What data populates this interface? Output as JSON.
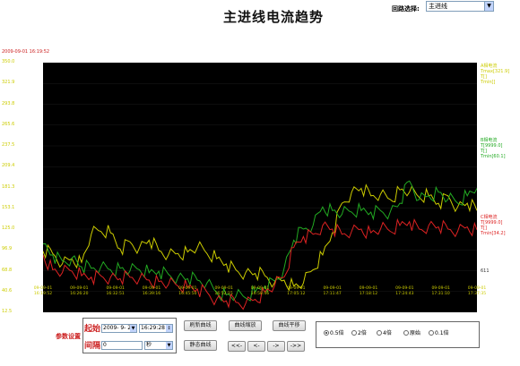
{
  "page": {
    "title": "主进线电流趋势",
    "circuit_label": "回路选择:",
    "circuit_value": "主进线"
  },
  "chart_data": {
    "type": "line",
    "timestamp": "2009-09-01 16:19:52",
    "y_ticks": [
      "350.0",
      "321.9",
      "293.8",
      "265.6",
      "237.5",
      "209.4",
      "181.3",
      "153.1",
      "125.0",
      "96.9",
      "68.8",
      "40.6",
      "12.5"
    ],
    "ylim": [
      12.5,
      350.0
    ],
    "x_ticks": [
      "09-09-01 16:19:52",
      "09-09-01 16:26:20",
      "09-09-01 16:32:51",
      "09-09-01 16:39:16",
      "09-09-01 16:45:50",
      "09-09-01 16:52:15",
      "09-09-01 16:58:46",
      "09-09-01 17:05:12",
      "09-09-01 17:11:47",
      "09-09-01 17:18:12",
      "09-09-01 17:24:43",
      "09-09-01 17:31:10",
      "09-09-01 17:37:35"
    ],
    "legend": [
      {
        "group": "A",
        "name": "A相电流",
        "lines": [
          "Tmax[321.9]",
          "T[]",
          "Tmin[]"
        ],
        "color": "#cccc00"
      },
      {
        "group": "B",
        "name": "B相电流",
        "lines": [
          "T[9999.0]",
          "T[]",
          "Tmin[60.1]"
        ],
        "color": "#22aa22"
      },
      {
        "group": "C",
        "name": "C相电流",
        "lines": [
          "T[9999.0]",
          "T[]",
          "Tmin[34.2]"
        ],
        "color": "#dd2222"
      }
    ],
    "cursor_value": "611",
    "series": [
      {
        "name": "A相电流",
        "color": "#cccc00",
        "values": [
          95,
          92,
          78,
          85,
          80,
          118,
          122,
          120,
          98,
          108,
          100,
          110,
          96,
          90,
          92,
          94,
          100,
          92,
          85,
          78,
          70,
          66,
          65,
          62,
          52,
          56,
          48,
          52,
          70,
          90,
          120,
          160,
          175,
          180,
          170,
          172,
          165,
          178,
          175,
          168,
          170,
          160,
          170,
          155,
          160,
          150
        ]
      },
      {
        "name": "B相电流",
        "color": "#22aa22",
        "values": [
          105,
          90,
          82,
          86,
          74,
          72,
          74,
          70,
          72,
          68,
          70,
          66,
          68,
          64,
          60,
          58,
          56,
          52,
          40,
          36,
          34,
          32,
          40,
          48,
          55,
          72,
          110,
          125,
          130,
          155,
          150,
          145,
          148,
          150,
          148,
          150,
          148,
          160,
          190,
          165,
          170,
          175,
          165,
          160,
          170,
          180
        ]
      },
      {
        "name": "C相电流",
        "color": "#dd2222",
        "values": [
          90,
          70,
          66,
          68,
          62,
          60,
          62,
          60,
          58,
          60,
          58,
          56,
          54,
          50,
          48,
          46,
          44,
          40,
          30,
          28,
          26,
          24,
          30,
          40,
          48,
          60,
          100,
          115,
          118,
          130,
          125,
          118,
          122,
          125,
          120,
          125,
          122,
          130,
          135,
          125,
          130,
          128,
          125,
          122,
          128,
          124
        ]
      }
    ]
  },
  "controls": {
    "param_label": "参数设置",
    "start_label": "起始",
    "start_date": "2009- 9- 2",
    "start_time": "16:29:28",
    "interval_label": "间隔",
    "interval_value": "0",
    "interval_unit": "秒",
    "btn_refresh": "刷新曲线",
    "btn_stop": "静态曲线",
    "btn_zoom_out": "曲线缩放",
    "btn_pan": "曲线平移",
    "nav_first": "<<-",
    "nav_prev": "<-",
    "nav_next": "->",
    "nav_last": "->>"
  },
  "zoom": {
    "options": [
      "0.5倍",
      "2倍",
      "4倍",
      "原始",
      "0.1倍"
    ],
    "selected": "0.5倍"
  }
}
